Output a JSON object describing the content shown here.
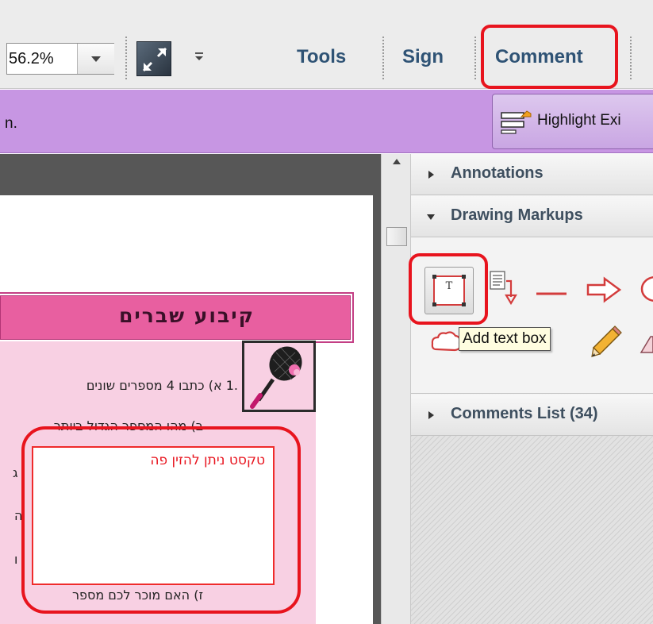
{
  "toolbar": {
    "zoom_value": "56.2%",
    "fit_icon": "fit-window-icon",
    "more_icon": "toolbar-more-icon",
    "tools_label": "Tools",
    "sign_label": "Sign",
    "comment_label": "Comment"
  },
  "notification": {
    "text": "n.",
    "button_label": "Highlight Exi",
    "button_icon": "highlight-fields-icon"
  },
  "document": {
    "title": "קיבוע שברים",
    "image_icon": "badminton-racket-icon",
    "line1": ".1 א) כתבו 4 מספרים שונים",
    "line2": "ב) מהו המספר הגדול ביותר",
    "line3": "ז) האם מוכר לכם מספר",
    "fragments": [
      "ג",
      "ה",
      "ו"
    ],
    "text_box_content": "טקסט ניתן להזין פה"
  },
  "panel": {
    "annotations_label": "Annotations",
    "drawing_markups_label": "Drawing Markups",
    "comments_list_label": "Comments List (34)",
    "tools": [
      {
        "icon": "add-text-box-icon"
      },
      {
        "icon": "text-callout-icon"
      },
      {
        "icon": "line-icon"
      },
      {
        "icon": "arrow-icon"
      },
      {
        "icon": "oval-icon"
      },
      {
        "icon": "cloud-icon"
      },
      {
        "icon": "pencil-icon"
      },
      {
        "icon": "eraser-icon"
      }
    ],
    "tooltip": "Add text box"
  },
  "colors": {
    "accent_red": "#e8141e",
    "notification_purple": "#c796e3",
    "title_pink": "#e85fa0",
    "content_pink": "#f8d0e3",
    "toolbar_text": "#2f5375"
  }
}
